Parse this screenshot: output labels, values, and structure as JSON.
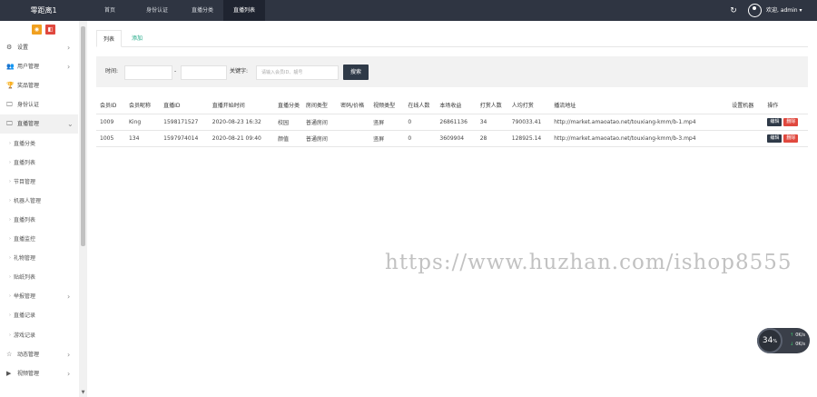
{
  "app": {
    "brand": "零距离1"
  },
  "topnav": [
    {
      "label": "首页",
      "active": false
    },
    {
      "label": "身份认证",
      "active": false
    },
    {
      "label": "直播分类",
      "active": false
    },
    {
      "label": "直播列表",
      "active": true
    }
  ],
  "header": {
    "refresh_icon": "refresh-icon",
    "user": "欢迎, admin ▾"
  },
  "sidebar": {
    "tool_colors": [
      "#f0a020",
      "#e0483e"
    ],
    "items": [
      {
        "label": "设置",
        "icon": "gear-icon",
        "glyph": "⚙",
        "arrow": "›",
        "sub": false
      },
      {
        "label": "用户管理",
        "icon": "users-icon",
        "glyph": "👥",
        "arrow": "›",
        "sub": false
      },
      {
        "label": "奖品管理",
        "icon": "trophy-icon",
        "glyph": "🏆",
        "arrow": "",
        "sub": false
      },
      {
        "label": "身份认证",
        "icon": "monitor-icon",
        "glyph": "🖵",
        "arrow": "",
        "sub": false
      },
      {
        "label": "直播管理",
        "icon": "monitor-icon",
        "glyph": "🖵",
        "arrow": "⌄",
        "sub": false,
        "active": true
      },
      {
        "label": "直播分类",
        "sub": true
      },
      {
        "label": "直播列表",
        "sub": true
      },
      {
        "label": "节目管理",
        "sub": true
      },
      {
        "label": "机器人管理",
        "sub": true
      },
      {
        "label": "直播列表",
        "sub": true
      },
      {
        "label": "直播监控",
        "sub": true
      },
      {
        "label": "礼物管理",
        "sub": true
      },
      {
        "label": "贴纸列表",
        "sub": true
      },
      {
        "label": "举报管理",
        "sub": true,
        "arrow": "›"
      },
      {
        "label": "直播记录",
        "sub": true
      },
      {
        "label": "游戏记录",
        "sub": true
      },
      {
        "label": "动态管理",
        "icon": "star-icon",
        "glyph": "☆",
        "arrow": "›",
        "sub": false
      },
      {
        "label": "视频管理",
        "icon": "video-icon",
        "glyph": "▶",
        "arrow": "›",
        "sub": false
      }
    ]
  },
  "tabs": [
    {
      "label": "列表",
      "active": true
    },
    {
      "label": "添加",
      "active": false
    }
  ],
  "filter": {
    "time_label": "时间:",
    "dash": "-",
    "keyword_label": "关键字:",
    "keyword_placeholder": "请输入会员ID、靓号",
    "search_label": "搜索"
  },
  "table": {
    "headers": [
      "会员ID",
      "会员昵称",
      "直播ID",
      "直播开始时间",
      "直播分类",
      "房间类型",
      "密码/价格",
      "视频类型",
      "在线人数",
      "本场收益",
      "打赏人数",
      "人均打赏",
      "播流地址",
      "设置机器",
      "操作"
    ],
    "rows": [
      {
        "cells": [
          "1009",
          "King",
          "1598171527",
          "2020-08-23 16:32",
          "校园",
          "普通房间",
          "",
          "竖屏",
          "0",
          "26861136",
          "34",
          "790033.41",
          "http://market.amaoatao.net/touxiang-kmm/b-1.mp4",
          ""
        ],
        "actions": [
          "编辑",
          "删除"
        ]
      },
      {
        "cells": [
          "1005",
          "134",
          "1597974014",
          "2020-08-21 09:40",
          "颜值",
          "普通房间",
          "",
          "竖屏",
          "0",
          "3609904",
          "28",
          "128925.14",
          "http://market.amaoatao.net/touxiang-kmm/b-3.mp4",
          ""
        ],
        "actions": [
          "编辑",
          "删除"
        ]
      }
    ]
  },
  "watermark": "https://www.huzhan.com/ishop8555",
  "speed": {
    "value": "34",
    "unit": "%",
    "up": "0K/s",
    "down": "0K/s"
  }
}
